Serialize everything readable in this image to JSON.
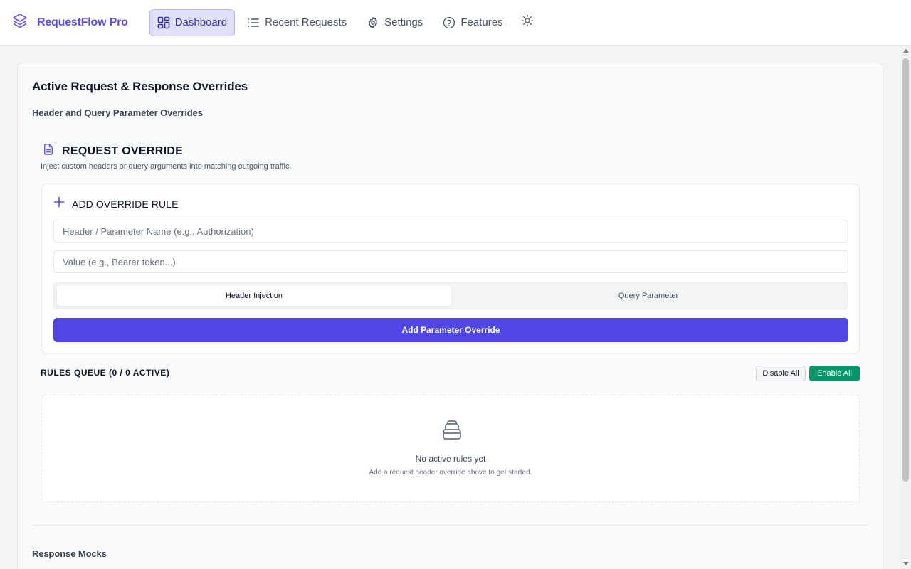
{
  "app": {
    "brand_name": "RequestFlow Pro",
    "brand_icon": "layers-icon",
    "accent_color": "#4f46e5"
  },
  "nav": {
    "items": [
      {
        "label": "Dashboard",
        "icon": "dashboard-icon",
        "active": true
      },
      {
        "label": "Recent Requests",
        "icon": "list-icon",
        "active": false
      },
      {
        "label": "Settings",
        "icon": "gear-icon",
        "active": false
      },
      {
        "label": "Features",
        "icon": "help-circle-icon",
        "active": false
      }
    ],
    "theme_icon": "sun-icon"
  },
  "main": {
    "title": "Active Request & Response Overrides",
    "section_header_overrides": "Header and Query Parameter Overrides",
    "section_response_mocks": "Response Mocks"
  },
  "request_override": {
    "icon": "document-icon",
    "title": "REQUEST OVERRIDE",
    "description": "Inject custom headers or query arguments into matching outgoing traffic."
  },
  "rule_form": {
    "heading_icon": "plus-icon",
    "heading": "ADD OVERRIDE RULE",
    "name_value": "",
    "name_placeholder": "Header / Parameter Name (e.g., Authorization)",
    "value_value": "",
    "value_placeholder": "Value (e.g., Bearer token...)",
    "type_options": [
      "Header Injection",
      "Query Parameter"
    ],
    "selected_type": "Header Injection",
    "submit_label": "Add Parameter Override"
  },
  "rules_queue": {
    "title": "RULES QUEUE (0 / 0 ACTIVE)",
    "disable_all_label": "Disable All",
    "enable_all_label": "Enable All",
    "enable_color": "#059669",
    "empty_icon": "inbox-icon",
    "empty_title": "No active rules yet",
    "empty_subtitle": "Add a request header override above to get started."
  }
}
